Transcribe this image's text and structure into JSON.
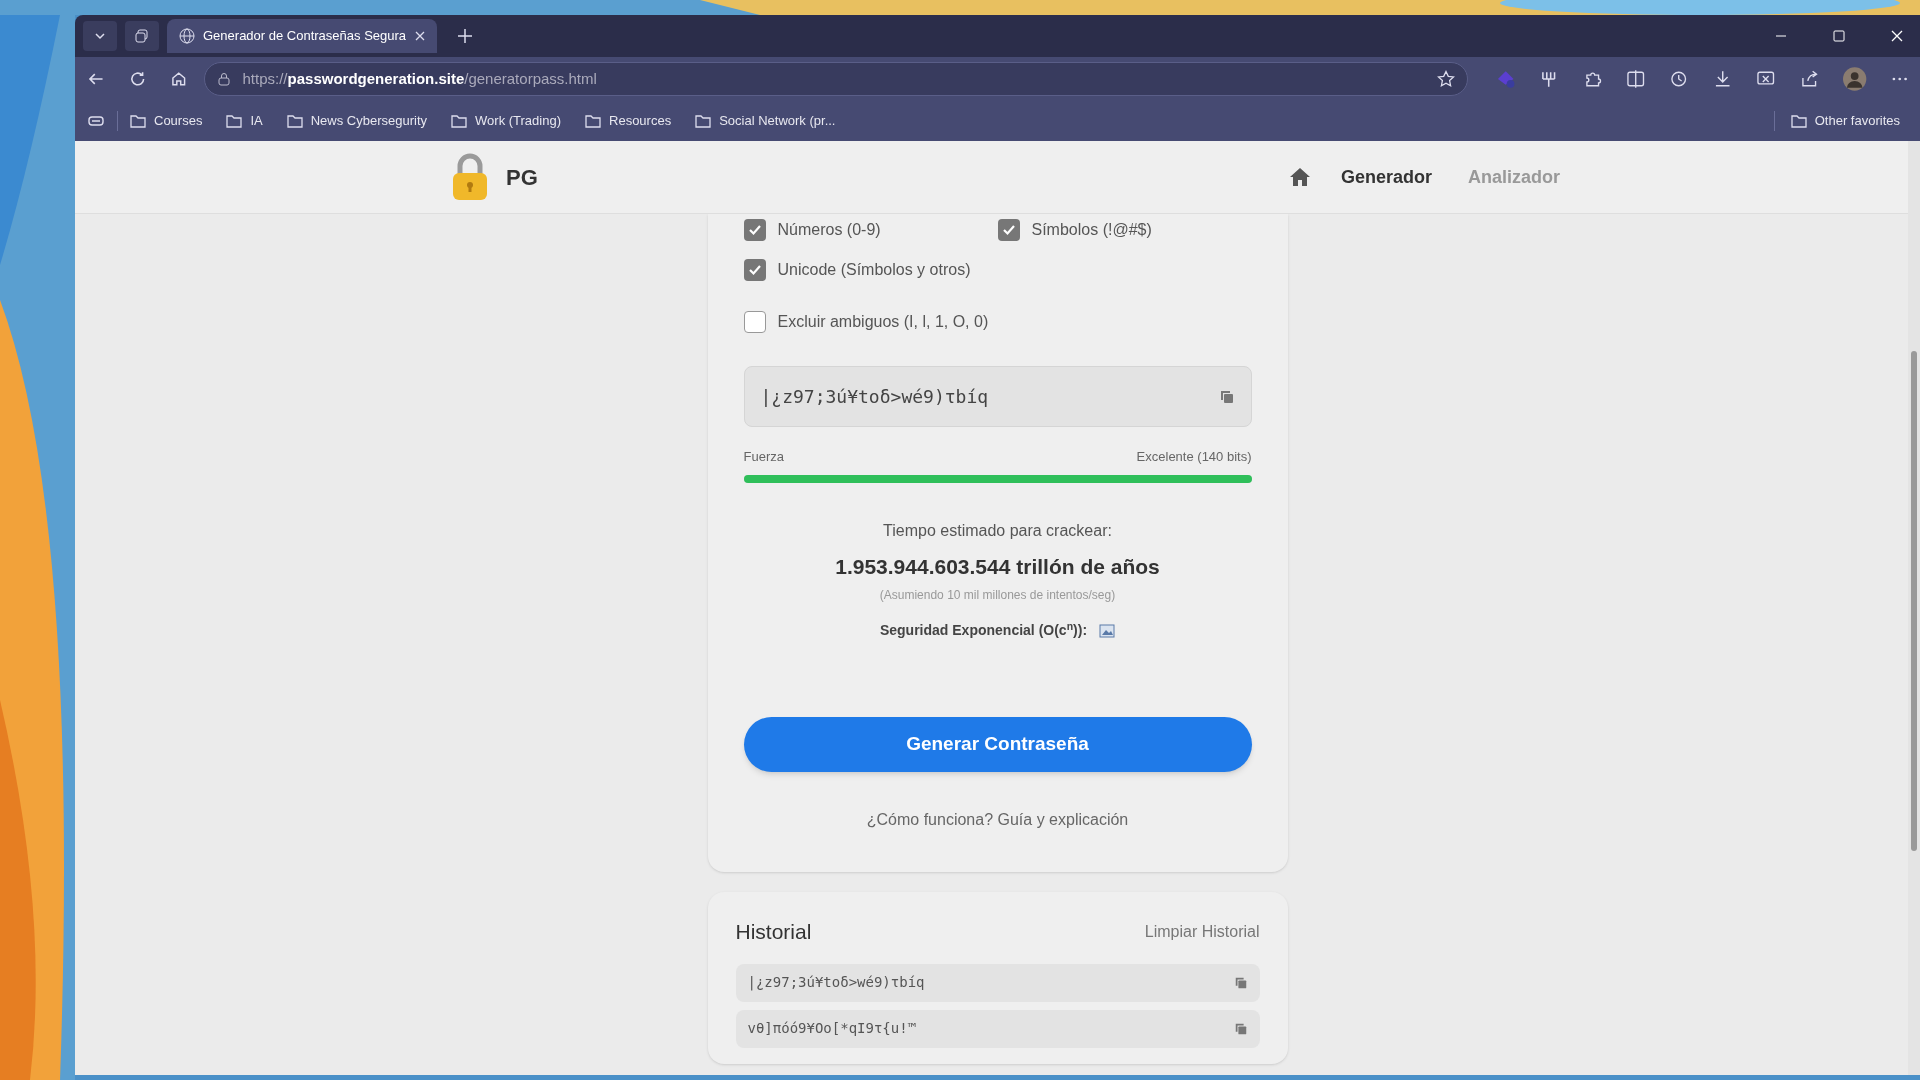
{
  "browser": {
    "tabs": [
      {
        "title": "Generador de Contraseñas Segura",
        "selected": true
      }
    ],
    "url": {
      "scheme": "https://",
      "domain": "passwordgeneration.site",
      "path": "/generatorpass.html"
    },
    "bookmarks": [
      "Courses",
      "IA",
      "News Cybersegurity",
      "Work (Trading)",
      "Resources",
      "Social Network (pr..."
    ],
    "other_favorites": "Other favorites"
  },
  "page": {
    "brand": "PG",
    "nav": [
      {
        "label": "Generador",
        "selected": true
      },
      {
        "label": "Analizador",
        "selected": false
      }
    ],
    "options": [
      {
        "label": "Números (0-9)",
        "checked": true
      },
      {
        "label": "Símbolos (!@#$)",
        "checked": true
      },
      {
        "label": "Unicode (Símbolos y otros)",
        "checked": true
      }
    ],
    "exclude_option": {
      "label": "Excluir ambiguos (I, l, 1, O, 0)",
      "checked": false
    },
    "password": "|¿z97;3ú¥toδ>wé9)τbíq",
    "strength": {
      "label": "Fuerza",
      "rating": "Excelente (140 bits)",
      "level": 1
    },
    "crack": {
      "heading": "Tiempo estimado para crackear:",
      "value": "1.953.944.603.544 trillón de años",
      "note": "(Asumiendo 10 mil millones de intentos/seg)"
    },
    "complexity": "Seguridad Exponencial (O(c$^{n}$)):",
    "generate_button": "Generar Contraseña",
    "help_link": "¿Cómo funciona? Guía y explicación",
    "history": {
      "title": "Historial",
      "clear": "Limpiar Historial",
      "items": [
        "|¿z97;3ú¥toδ>wé9)τbíq",
        "vθ]πóó9¥Oo[*qI9τ{u!™"
      ]
    }
  }
}
